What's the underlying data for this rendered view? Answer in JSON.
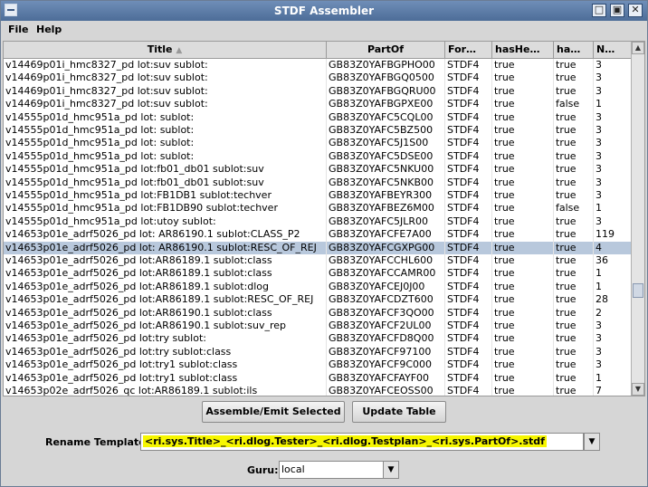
{
  "window": {
    "title": "STDF Assembler"
  },
  "menu": {
    "items": [
      "File",
      "Help"
    ]
  },
  "table": {
    "columns": [
      "Title",
      "PartOf",
      "For…",
      "hasHe…",
      "ha…",
      "N…"
    ],
    "sort_icon": "sort-ascending-icon",
    "selected_row": 14,
    "rows": [
      [
        "v14469p01i_hmc8327_pd lot:suv sublot:",
        "GB83Z0YAFBGPHO00",
        "STDF4",
        "true",
        "true",
        "3"
      ],
      [
        "v14469p01i_hmc8327_pd lot:suv sublot:",
        "GB83Z0YAFBGQ0500",
        "STDF4",
        "true",
        "true",
        "3"
      ],
      [
        "v14469p01i_hmc8327_pd lot:suv sublot:",
        "GB83Z0YAFBGQRU00",
        "STDF4",
        "true",
        "true",
        "3"
      ],
      [
        "v14469p01i_hmc8327_pd lot:suv sublot:",
        "GB83Z0YAFBGPXE00",
        "STDF4",
        "true",
        "false",
        "1"
      ],
      [
        "v14555p01d_hmc951a_pd lot: sublot:",
        "GB83Z0YAFC5CQL00",
        "STDF4",
        "true",
        "true",
        "3"
      ],
      [
        "v14555p01d_hmc951a_pd lot: sublot:",
        "GB83Z0YAFC5BZ500",
        "STDF4",
        "true",
        "true",
        "3"
      ],
      [
        "v14555p01d_hmc951a_pd lot: sublot:",
        "GB83Z0YAFC5J1S00",
        "STDF4",
        "true",
        "true",
        "3"
      ],
      [
        "v14555p01d_hmc951a_pd lot: sublot:",
        "GB83Z0YAFC5DSE00",
        "STDF4",
        "true",
        "true",
        "3"
      ],
      [
        "v14555p01d_hmc951a_pd lot:fb01_db01 sublot:suv",
        "GB83Z0YAFC5NKU00",
        "STDF4",
        "true",
        "true",
        "3"
      ],
      [
        "v14555p01d_hmc951a_pd lot:fb01_db01 sublot:suv",
        "GB83Z0YAFC5NKB00",
        "STDF4",
        "true",
        "true",
        "3"
      ],
      [
        "v14555p01d_hmc951a_pd lot:FB1DB1 sublot:techver",
        "GB83Z0YAFBEYR300",
        "STDF4",
        "true",
        "true",
        "3"
      ],
      [
        "v14555p01d_hmc951a_pd lot:FB1DB90 sublot:techver",
        "GB83Z0YAFBEZ6M00",
        "STDF4",
        "true",
        "false",
        "1"
      ],
      [
        "v14555p01d_hmc951a_pd lot:utoy sublot:",
        "GB83Z0YAFC5JLR00",
        "STDF4",
        "true",
        "true",
        "3"
      ],
      [
        "v14653p01e_adrf5026_pd lot: AR86190.1 sublot:CLASS_P2",
        "GB83Z0YAFCFE7A00",
        "STDF4",
        "true",
        "true",
        "119"
      ],
      [
        "v14653p01e_adrf5026_pd lot: AR86190.1 sublot:RESC_OF_REJ",
        "GB83Z0YAFCGXPG00",
        "STDF4",
        "true",
        "true",
        "4"
      ],
      [
        "v14653p01e_adrf5026_pd lot:AR86189.1 sublot:class",
        "GB83Z0YAFCCHL600",
        "STDF4",
        "true",
        "true",
        "36"
      ],
      [
        "v14653p01e_adrf5026_pd lot:AR86189.1 sublot:class",
        "GB83Z0YAFCCAMR00",
        "STDF4",
        "true",
        "true",
        "1"
      ],
      [
        "v14653p01e_adrf5026_pd lot:AR86189.1 sublot:dlog",
        "GB83Z0YAFCEJ0J00",
        "STDF4",
        "true",
        "true",
        "1"
      ],
      [
        "v14653p01e_adrf5026_pd lot:AR86189.1 sublot:RESC_OF_REJ",
        "GB83Z0YAFCDZT600",
        "STDF4",
        "true",
        "true",
        "28"
      ],
      [
        "v14653p01e_adrf5026_pd lot:AR86190.1 sublot:class",
        "GB83Z0YAFCF3QO00",
        "STDF4",
        "true",
        "true",
        "2"
      ],
      [
        "v14653p01e_adrf5026_pd lot:AR86190.1 sublot:suv_rep",
        "GB83Z0YAFCF2UL00",
        "STDF4",
        "true",
        "true",
        "3"
      ],
      [
        "v14653p01e_adrf5026_pd lot:try sublot:",
        "GB83Z0YAFCFD8Q00",
        "STDF4",
        "true",
        "true",
        "3"
      ],
      [
        "v14653p01e_adrf5026_pd lot:try sublot:class",
        "GB83Z0YAFCF97100",
        "STDF4",
        "true",
        "true",
        "3"
      ],
      [
        "v14653p01e_adrf5026_pd lot:try1 sublot:class",
        "GB83Z0YAFCF9C000",
        "STDF4",
        "true",
        "true",
        "3"
      ],
      [
        "v14653p01e_adrf5026_pd lot:try1 sublot:class",
        "GB83Z0YAFCFAYF00",
        "STDF4",
        "true",
        "true",
        "1"
      ],
      [
        "v14653p02e_adrf5026_qc lot:AR86189.1 sublot:ils",
        "GB83Z0YAFCEOSS00",
        "STDF4",
        "true",
        "true",
        "7"
      ]
    ]
  },
  "actions": {
    "assemble_label": "Assemble/Emit Selected",
    "update_label": "Update Table"
  },
  "rename": {
    "label": "Rename Template:",
    "value": "<ri.sys.Title>_<ri.dlog.Tester>_<ri.dlog.Testplan>_<ri.sys.PartOf>.stdf",
    "highlight_color": "#f7f31a"
  },
  "guru": {
    "label": "Guru:",
    "value": "local"
  },
  "colors": {
    "titlebar": "#5a7aa6",
    "selected_row": "#b8c8dc"
  }
}
